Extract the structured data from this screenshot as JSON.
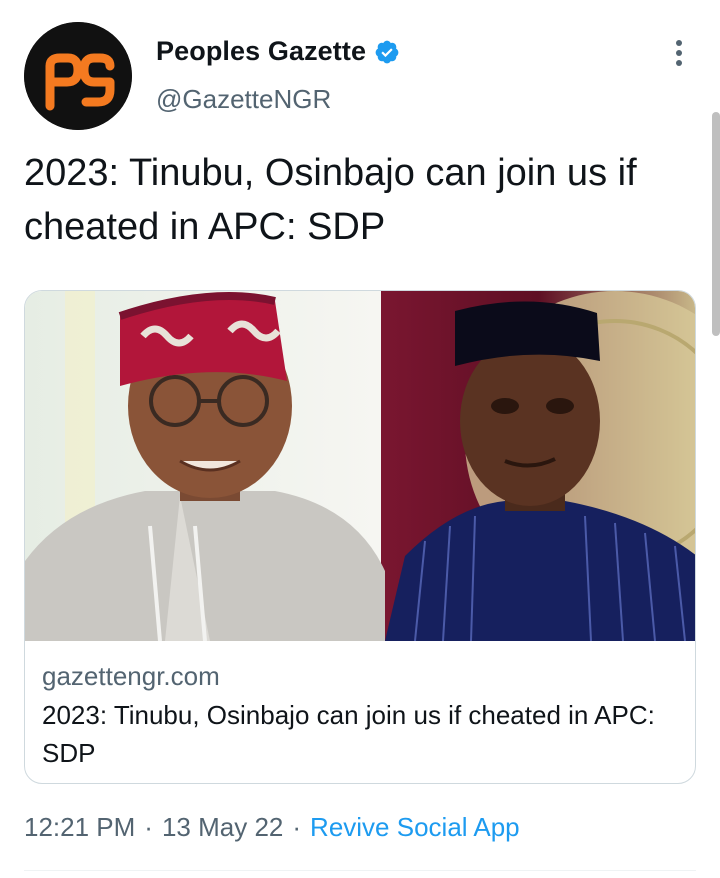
{
  "account": {
    "display_name": "Peoples Gazette",
    "handle": "@GazetteNGR",
    "verified": true,
    "avatar_icon": "pg-logo-icon",
    "avatar_text": "pg"
  },
  "tweet": {
    "text": "2023: Tinubu, Osinbajo can join us if cheated in APC: SDP"
  },
  "card": {
    "domain": "gazettengr.com",
    "title": "2023: Tinubu, Osinbajo can join us if cheated in APC: SDP"
  },
  "meta": {
    "time": "12:21 PM",
    "separator": "·",
    "date": "13 May 22",
    "source": "Revive Social App"
  },
  "colors": {
    "brand_orange": "#f47a20",
    "link_blue": "#1d9bf0",
    "secondary_text": "#536471",
    "primary_text": "#0f1419"
  },
  "icons": {
    "verified": "verified-badge-icon",
    "more": "more-options-icon"
  }
}
